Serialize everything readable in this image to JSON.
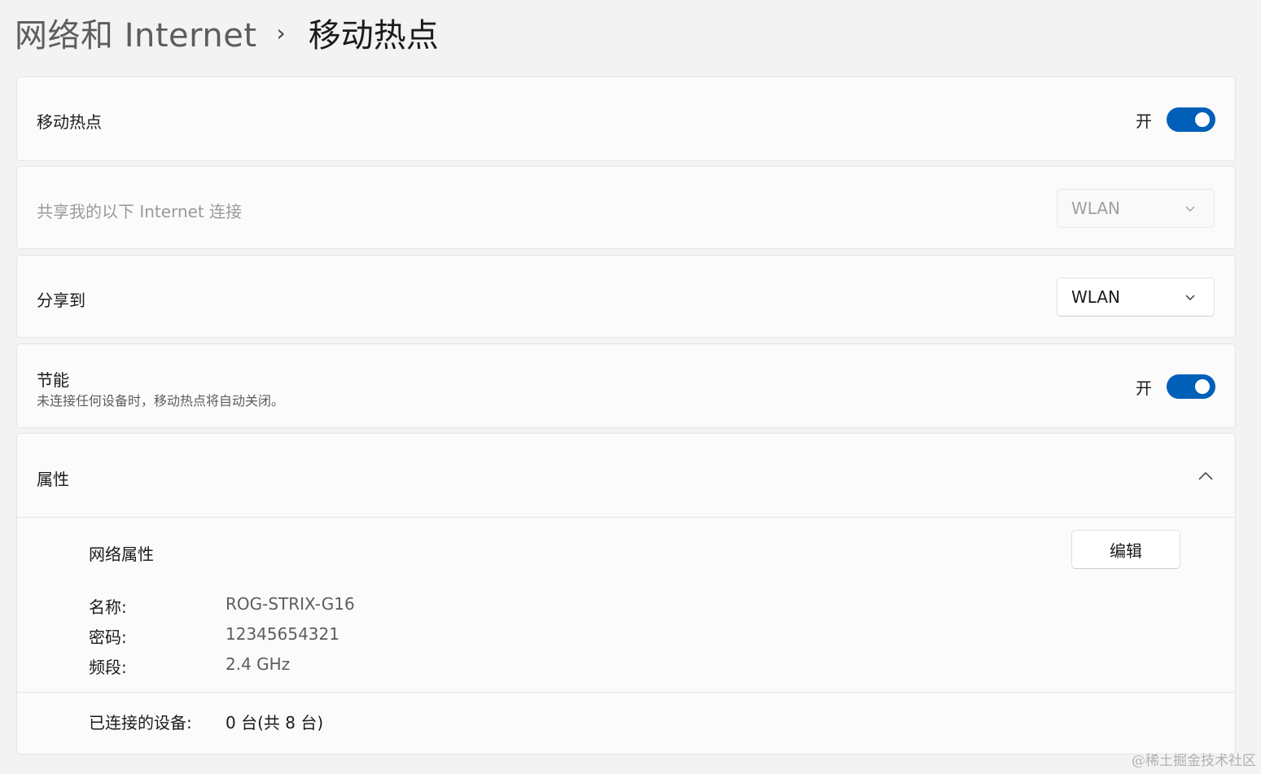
{
  "breadcrumb": {
    "parent": "网络和 Internet",
    "separator": "›",
    "current": "移动热点"
  },
  "hotspot": {
    "label": "移动热点",
    "state_text": "开",
    "enabled": true
  },
  "share_from": {
    "label": "共享我的以下 Internet 连接",
    "selected": "WLAN",
    "disabled": true
  },
  "share_to": {
    "label": "分享到",
    "selected": "WLAN"
  },
  "power_saving": {
    "label": "节能",
    "description": "未连接任何设备时，移动热点将自动关闭。",
    "state_text": "开",
    "enabled": true
  },
  "properties": {
    "label": "属性",
    "expanded": true,
    "network_properties_label": "网络属性",
    "edit_button": "编辑",
    "name_key": "名称:",
    "name_value": "ROG-STRIX-G16",
    "password_key": "密码:",
    "password_value": "12345654321",
    "band_key": "频段:",
    "band_value": "2.4 GHz",
    "devices_key": "已连接的设备:",
    "devices_value": "0 台(共 8 台)"
  },
  "watermark": "@稀土掘金技术社区",
  "colors": {
    "accent": "#005fb8",
    "background": "#f3f3f3",
    "card": "#fbfbfb"
  }
}
